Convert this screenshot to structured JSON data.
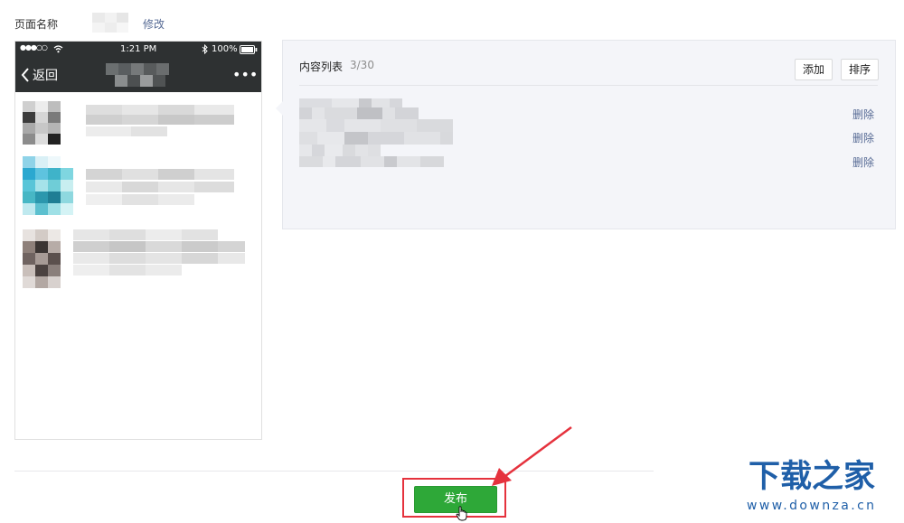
{
  "page_name": {
    "label": "页面名称",
    "modify_link": "修改"
  },
  "phone": {
    "status": {
      "carrier_signal": "●●●○○",
      "time": "1:21 PM",
      "battery": "100%"
    },
    "nav": {
      "back_label": "返回",
      "more": "•••"
    }
  },
  "content_list": {
    "title": "内容列表",
    "count": "3/30",
    "add_button": "添加",
    "sort_button": "排序",
    "delete_labels": [
      "删除",
      "删除",
      "删除"
    ]
  },
  "publish_button": "发布",
  "watermark": {
    "logo": "下载之家",
    "url": "www.downza.cn"
  },
  "colors": {
    "accent_green": "#2ea838",
    "highlight_red": "#e5323d",
    "link_blue": "#576b95",
    "phone_bar": "#2e3132"
  }
}
